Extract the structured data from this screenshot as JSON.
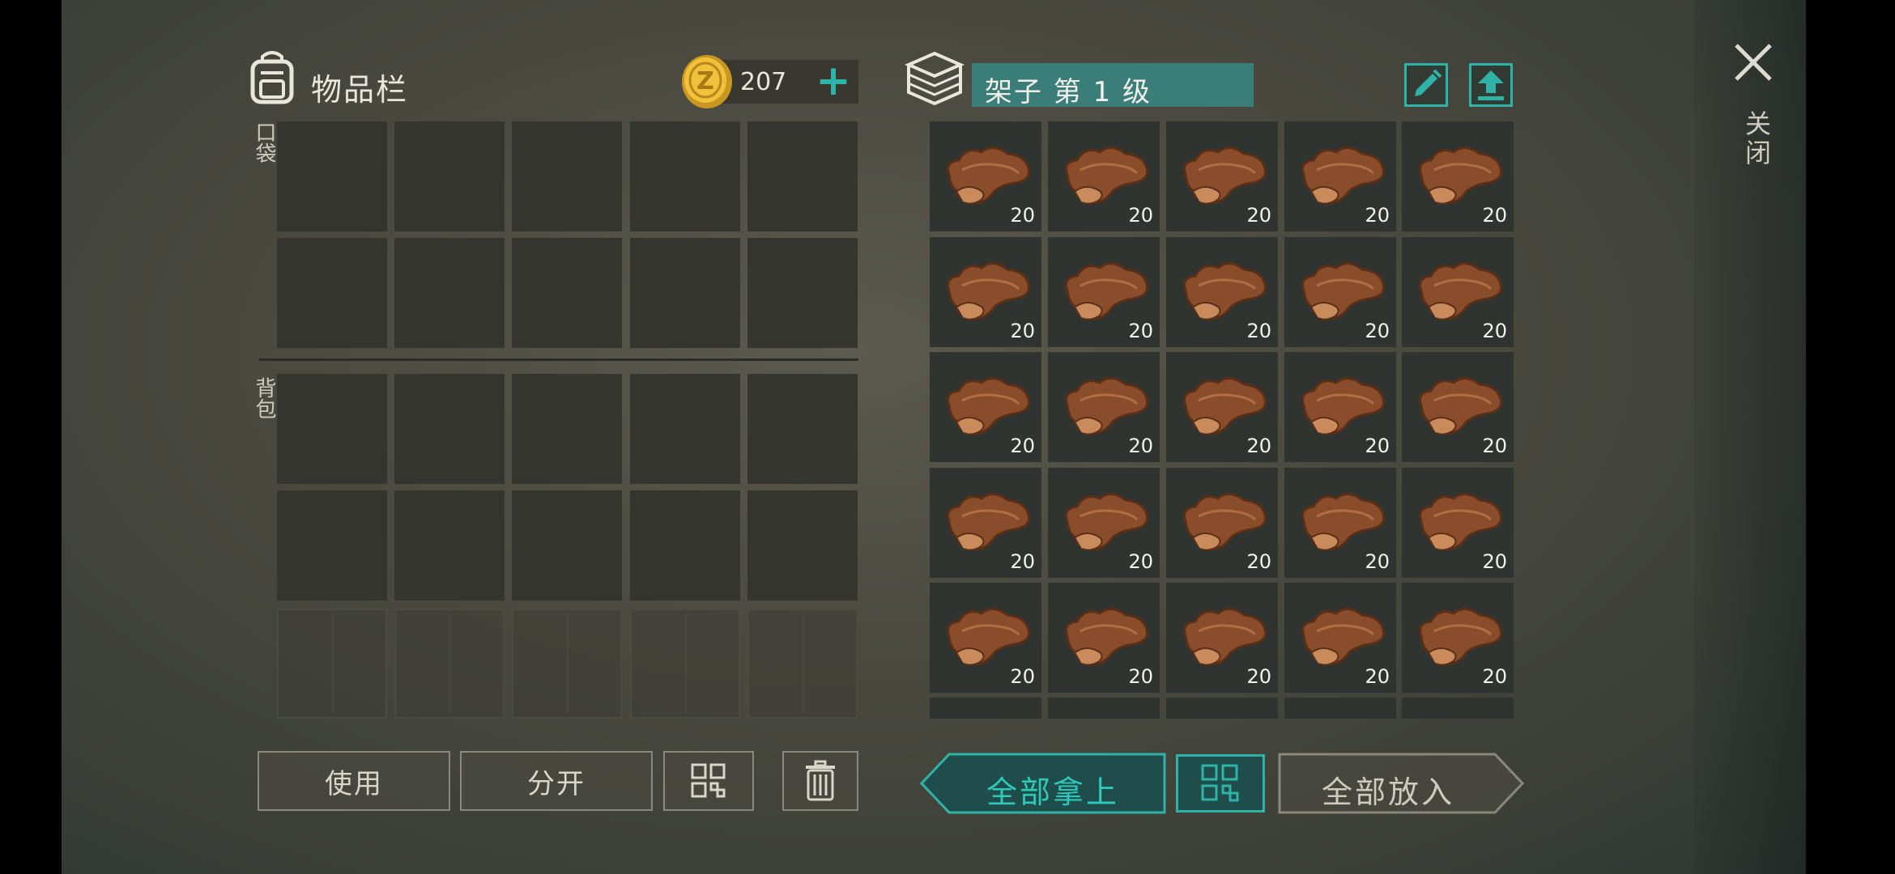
{
  "inventory": {
    "title": "物品栏",
    "coins": "207",
    "pocket_label": "口袋",
    "backpack_label": "背包",
    "use_button": "使用",
    "split_button": "分开"
  },
  "container": {
    "title": "架子 第 1 级",
    "close_label": "关闭",
    "take_all_button": "全部拿上",
    "put_all_button": "全部放入",
    "item_name": "leather",
    "item_counts": [
      "20",
      "20",
      "20",
      "20",
      "20",
      "20",
      "20",
      "20",
      "20",
      "20",
      "20",
      "20",
      "20",
      "20",
      "20",
      "20",
      "20",
      "20",
      "20",
      "20",
      "20",
      "20",
      "20",
      "20",
      "20"
    ]
  },
  "colors": {
    "accent": "#2fb3a6",
    "title_bar": "#3b7e79",
    "slot": "#34352f",
    "item_slot": "#2f3431",
    "leather": "#9a5a35"
  }
}
